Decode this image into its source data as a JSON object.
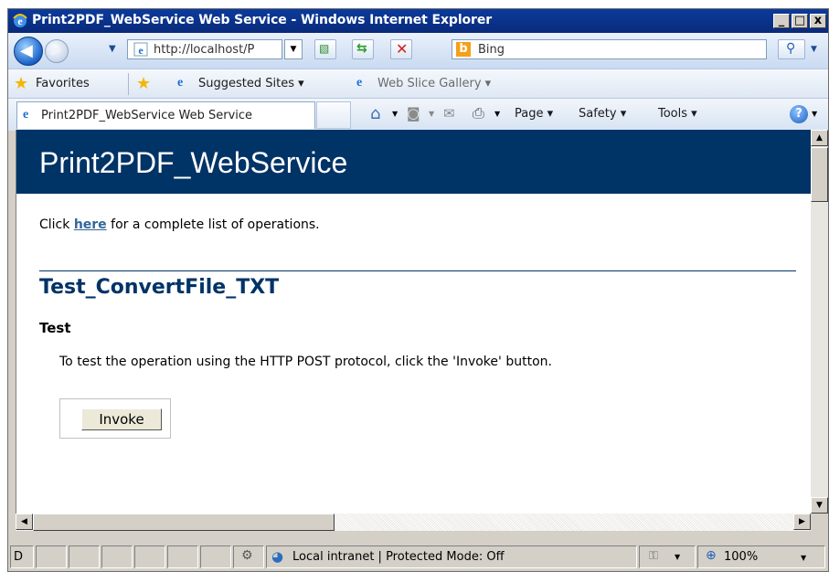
{
  "window": {
    "title": "Print2PDF_WebService Web Service - Windows Internet Explorer",
    "min": "_",
    "max": "□",
    "close": "x"
  },
  "nav": {
    "address": "http://localhost/P",
    "search_placeholder": "Bing"
  },
  "favorites_bar": {
    "favorites": "Favorites",
    "suggested_sites": "Suggested Sites ▾",
    "web_slice_gallery": "Web Slice Gallery ▾"
  },
  "tab": {
    "label": "Print2PDF_WebService Web Service"
  },
  "commands": {
    "page": "Page",
    "safety": "Safety",
    "tools": "Tools"
  },
  "content": {
    "page_title": "Print2PDF_WebService",
    "intro_before": "Click ",
    "intro_link": "here",
    "intro_after": " for a complete list of operations.",
    "operation_title": "Test_ConvertFile_TXT",
    "test_heading": "Test",
    "test_description": "To test the operation using the HTTP POST protocol, click the 'Invoke' button.",
    "invoke_label": "Invoke"
  },
  "status": {
    "first_cell": "D",
    "zone": "Local intranet | Protected Mode: Off",
    "zoom": "100%"
  },
  "colors": {
    "title_bar": "#0a2a7a",
    "heading_band": "#003366",
    "link": "#336699"
  }
}
